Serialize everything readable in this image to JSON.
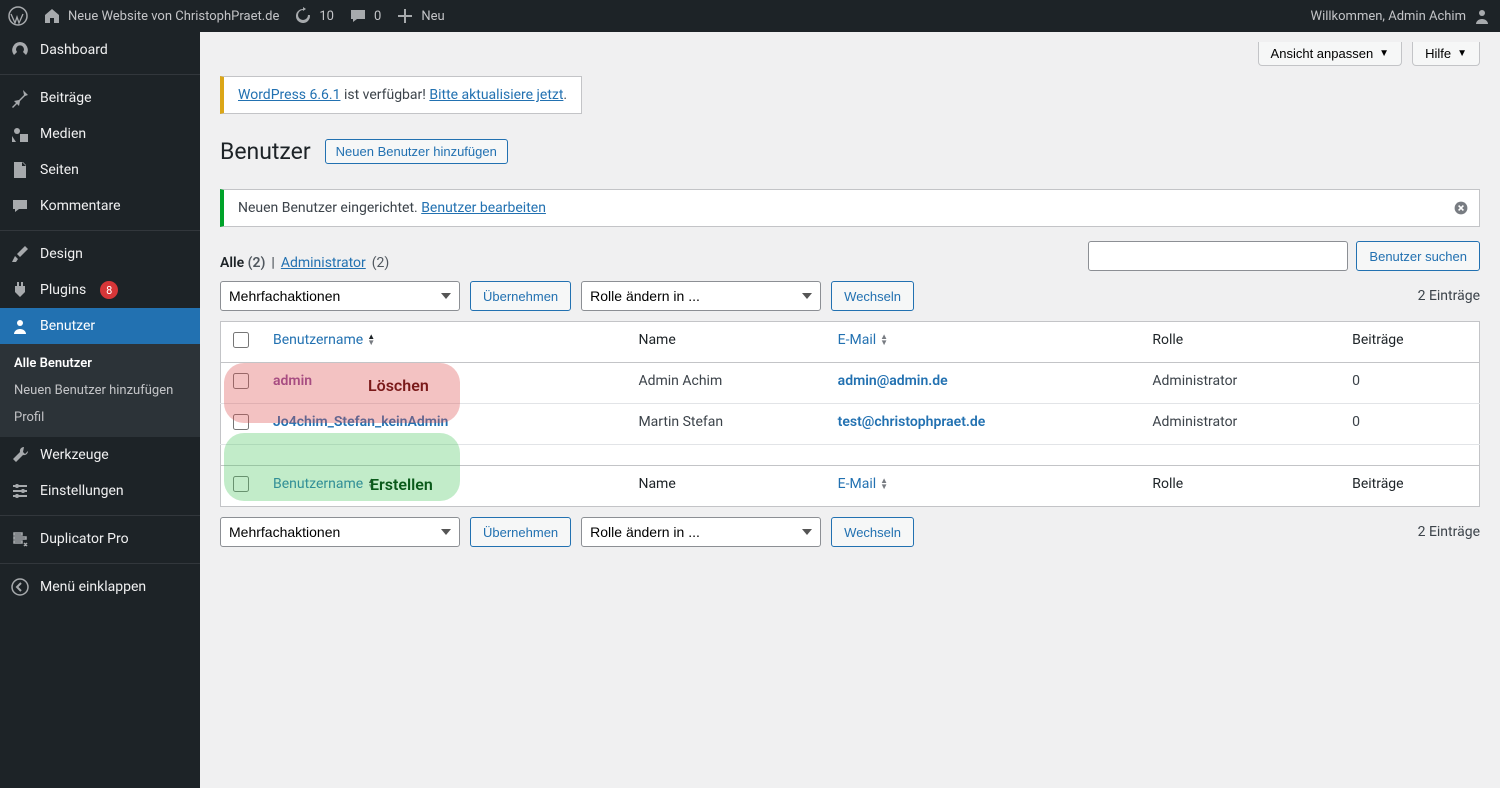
{
  "adminbar": {
    "site_name": "Neue Website von ChristophPraet.de",
    "updates": "10",
    "comments": "0",
    "new": "Neu",
    "greeting": "Willkommen, Admin Achim"
  },
  "sidebar": {
    "dashboard": "Dashboard",
    "posts": "Beiträge",
    "media": "Medien",
    "pages": "Seiten",
    "comments": "Kommentare",
    "appearance": "Design",
    "plugins": "Plugins",
    "plugins_count": "8",
    "users": "Benutzer",
    "tools": "Werkzeuge",
    "settings": "Einstellungen",
    "duplicator": "Duplicator Pro",
    "collapse": "Menü einklappen",
    "submenu": {
      "all": "Alle Benutzer",
      "add": "Neuen Benutzer hinzufügen",
      "profile": "Profil"
    }
  },
  "screen": {
    "options": "Ansicht anpassen",
    "help": "Hilfe"
  },
  "update_notice": {
    "prefix": "WordPress 6.6.1",
    "middle": " ist verfügbar! ",
    "link": "Bitte aktualisiere jetzt",
    "suffix": "."
  },
  "heading": "Benutzer",
  "add_new": "Neuen Benutzer hinzufügen",
  "success_notice": {
    "text": "Neuen Benutzer eingerichtet. ",
    "link": "Benutzer bearbeiten"
  },
  "subsubsub": {
    "all_label": "Alle",
    "all_count": "(2)",
    "sep": "|",
    "admin_label": "Administrator",
    "admin_count": "(2)"
  },
  "search_button": "Benutzer suchen",
  "bulk_select": "Mehrfachaktionen",
  "apply": "Übernehmen",
  "role_select": "Rolle ändern in ...",
  "change": "Wechseln",
  "displaying": "2 Einträge",
  "columns": {
    "username": "Benutzername",
    "name": "Name",
    "email": "E-Mail",
    "role": "Rolle",
    "posts": "Beiträge"
  },
  "rows": [
    {
      "username": "admin",
      "name": "Admin Achim",
      "email": "admin@admin.de",
      "role": "Administrator",
      "posts": "0"
    },
    {
      "username": "Jo4chim_Stefan_keinAdmin",
      "name": "Martin Stefan",
      "email": "test@christophpraet.de",
      "role": "Administrator",
      "posts": "0"
    }
  ],
  "annotations": {
    "delete": "Löschen",
    "create": "Erstellen"
  }
}
